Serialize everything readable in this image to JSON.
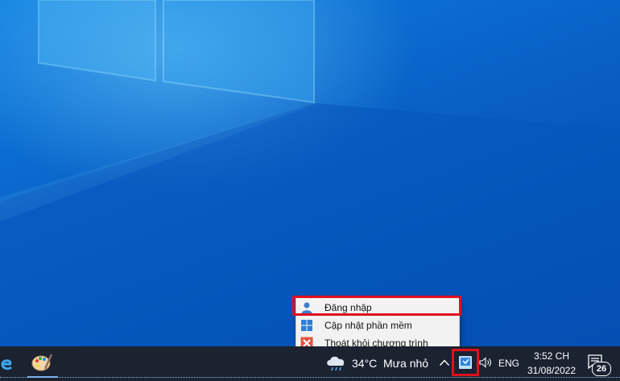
{
  "context_menu": {
    "items": [
      {
        "label": "Đăng nhập",
        "icon": "user-icon"
      },
      {
        "label": "Cập nhật phần mềm",
        "icon": "windows-icon"
      },
      {
        "label": "Thoát khỏi chương trình",
        "icon": "close-icon"
      }
    ]
  },
  "taskbar": {
    "pinned": [
      {
        "icon": "internet-explorer-icon"
      },
      {
        "icon": "paint-icon"
      }
    ],
    "weather": {
      "temperature": "34°C",
      "description": "Mưa nhỏ",
      "icon": "cloud-rain-icon"
    },
    "tray": {
      "overflow_icon": "chevron-up-icon",
      "app_icon": "app-tray-icon",
      "volume_icon": "volume-icon",
      "language": "ENG"
    },
    "clock": {
      "time": "3:52 CH",
      "date": "31/08/2022"
    },
    "notifications": {
      "count": "26",
      "icon": "notification-icon"
    }
  },
  "colors": {
    "highlight": "#e0101c",
    "taskbar": "#1b2230",
    "menu_background": "#f2f2f2",
    "desktop": "#0a5fc4"
  }
}
